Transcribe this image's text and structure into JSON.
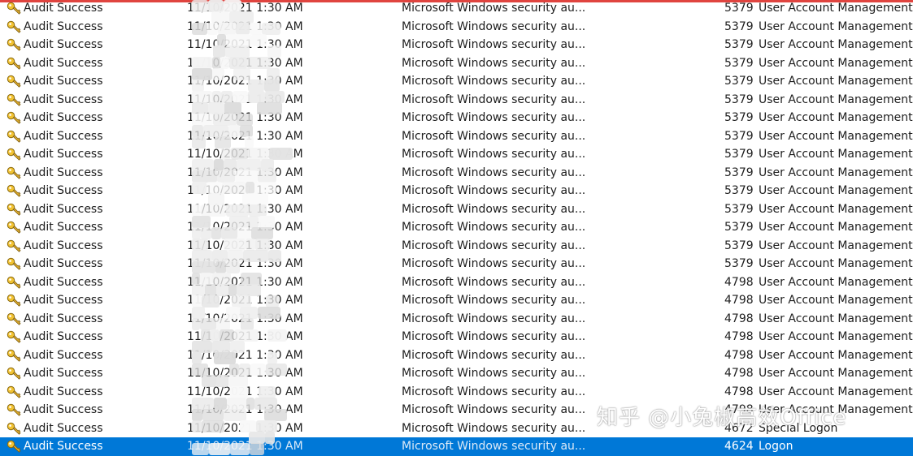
{
  "event_list": {
    "rows": [
      {
        "keyword": "Audit Success",
        "date_time": "11/10/2021 1:30 AM",
        "source": "Microsoft Windows security au...",
        "event_id": "5379",
        "category": "User Account Management"
      },
      {
        "keyword": "Audit Success",
        "date_time": "11/10/2021 1:30 AM",
        "source": "Microsoft Windows security au...",
        "event_id": "5379",
        "category": "User Account Management"
      },
      {
        "keyword": "Audit Success",
        "date_time": "11/10/2021 1:30 AM",
        "source": "Microsoft Windows security au...",
        "event_id": "5379",
        "category": "User Account Management"
      },
      {
        "keyword": "Audit Success",
        "date_time": "11/10/2021 1:30 AM",
        "source": "Microsoft Windows security au...",
        "event_id": "5379",
        "category": "User Account Management"
      },
      {
        "keyword": "Audit Success",
        "date_time": "11/10/2021 1:30 AM",
        "source": "Microsoft Windows security au...",
        "event_id": "5379",
        "category": "User Account Management"
      },
      {
        "keyword": "Audit Success",
        "date_time": "11/10/2021 1:30 AM",
        "source": "Microsoft Windows security au...",
        "event_id": "5379",
        "category": "User Account Management"
      },
      {
        "keyword": "Audit Success",
        "date_time": "11/10/2021 1:30 AM",
        "source": "Microsoft Windows security au...",
        "event_id": "5379",
        "category": "User Account Management"
      },
      {
        "keyword": "Audit Success",
        "date_time": "11/10/2021 1:30 AM",
        "source": "Microsoft Windows security au...",
        "event_id": "5379",
        "category": "User Account Management"
      },
      {
        "keyword": "Audit Success",
        "date_time": "11/10/2021 1:30 AM",
        "source": "Microsoft Windows security au...",
        "event_id": "5379",
        "category": "User Account Management"
      },
      {
        "keyword": "Audit Success",
        "date_time": "11/10/2021 1:30 AM",
        "source": "Microsoft Windows security au...",
        "event_id": "5379",
        "category": "User Account Management"
      },
      {
        "keyword": "Audit Success",
        "date_time": "11/10/2021 1:30 AM",
        "source": "Microsoft Windows security au...",
        "event_id": "5379",
        "category": "User Account Management"
      },
      {
        "keyword": "Audit Success",
        "date_time": "11/10/2021 1:30 AM",
        "source": "Microsoft Windows security au...",
        "event_id": "5379",
        "category": "User Account Management"
      },
      {
        "keyword": "Audit Success",
        "date_time": "11/10/2021 1:30 AM",
        "source": "Microsoft Windows security au...",
        "event_id": "5379",
        "category": "User Account Management"
      },
      {
        "keyword": "Audit Success",
        "date_time": "11/10/2021 1:30 AM",
        "source": "Microsoft Windows security au...",
        "event_id": "5379",
        "category": "User Account Management"
      },
      {
        "keyword": "Audit Success",
        "date_time": "11/10/2021 1:30 AM",
        "source": "Microsoft Windows security au...",
        "event_id": "5379",
        "category": "User Account Management"
      },
      {
        "keyword": "Audit Success",
        "date_time": "11/10/2021 1:30 AM",
        "source": "Microsoft Windows security au...",
        "event_id": "4798",
        "category": "User Account Management"
      },
      {
        "keyword": "Audit Success",
        "date_time": "11/10/2021 1:30 AM",
        "source": "Microsoft Windows security au...",
        "event_id": "4798",
        "category": "User Account Management"
      },
      {
        "keyword": "Audit Success",
        "date_time": "11/10/2021 1:30 AM",
        "source": "Microsoft Windows security au...",
        "event_id": "4798",
        "category": "User Account Management"
      },
      {
        "keyword": "Audit Success",
        "date_time": "11/10/2021 1:30 AM",
        "source": "Microsoft Windows security au...",
        "event_id": "4798",
        "category": "User Account Management"
      },
      {
        "keyword": "Audit Success",
        "date_time": "11/10/2021 1:30 AM",
        "source": "Microsoft Windows security au...",
        "event_id": "4798",
        "category": "User Account Management"
      },
      {
        "keyword": "Audit Success",
        "date_time": "11/10/2021 1:30 AM",
        "source": "Microsoft Windows security au...",
        "event_id": "4798",
        "category": "User Account Management"
      },
      {
        "keyword": "Audit Success",
        "date_time": "11/10/2021 1:30 AM",
        "source": "Microsoft Windows security au...",
        "event_id": "4798",
        "category": "User Account Management"
      },
      {
        "keyword": "Audit Success",
        "date_time": "11/10/2021 1:30 AM",
        "source": "Microsoft Windows security au...",
        "event_id": "4798",
        "category": "User Account Management"
      },
      {
        "keyword": "Audit Success",
        "date_time": "11/10/2021 1:30 AM",
        "source": "Microsoft Windows security au...",
        "event_id": "4672",
        "category": "Special Logon"
      },
      {
        "keyword": "Audit Success",
        "date_time": "11/10/2021 1:30 AM",
        "source": "Microsoft Windows security au...",
        "event_id": "4624",
        "category": "Logon",
        "selected": true
      }
    ]
  },
  "icons": {
    "row_icon": "key-icon"
  },
  "colors": {
    "selection": "#0078d7",
    "top_border": "#e0443f"
  },
  "watermark": {
    "text": "知乎 @小兔椒高效Office"
  }
}
